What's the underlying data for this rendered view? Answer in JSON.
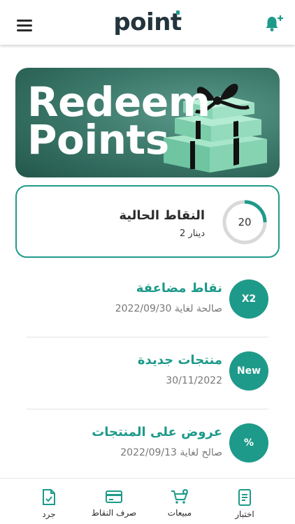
{
  "header": {
    "logo_text": "point",
    "menu_icon": "hamburger-menu-icon",
    "bell_icon": "bell-plus-icon"
  },
  "banner": {
    "line1": "Redeem",
    "line2": "Points"
  },
  "points": {
    "title": "النقاط الحالية",
    "subtitle": "دينار 2",
    "value": "20",
    "progress_fraction": 0.25
  },
  "offers": [
    {
      "badge": "X2",
      "title": "نقاط مضاعفة",
      "date": "صالحة لغاية 2022/09/30"
    },
    {
      "badge": "New",
      "title": "منتجات جديدة",
      "date": "30/11/2022"
    },
    {
      "badge": "%",
      "title": "عروض على المنتجات",
      "date": "صالح لغاية 2022/09/13"
    }
  ],
  "bottom_nav": [
    {
      "label": "جرد",
      "icon": "inventory-check-icon"
    },
    {
      "label": "صرف النقاط",
      "icon": "credit-card-icon"
    },
    {
      "label": "مبيعات",
      "icon": "cart-plus-icon"
    },
    {
      "label": "اختبار",
      "icon": "test-document-icon"
    }
  ],
  "colors": {
    "accent": "#1e9a8a",
    "logo": "#23343d",
    "banner_green": "#3d7a6c",
    "gift_box": "#8fd8b8",
    "ribbon": "#111111"
  }
}
